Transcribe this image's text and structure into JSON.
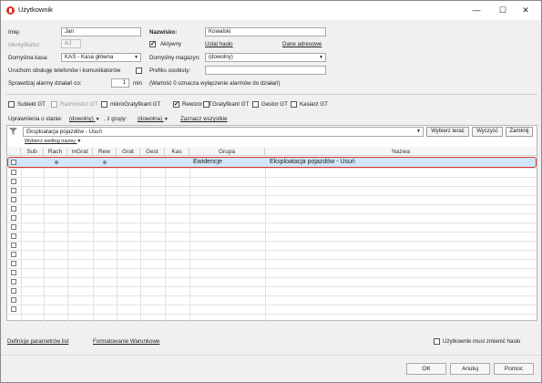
{
  "window": {
    "title": "Użytkownik",
    "minimize": "—",
    "maximize": "☐",
    "close": "✕"
  },
  "form": {
    "imie_label": "Imię:",
    "imie_value": "Jan",
    "nazwisko_label": "Nazwisko:",
    "nazwisko_value": "Kowalski",
    "identyfikator_label": "Identyfikator:",
    "identyfikator_value": "AJ",
    "aktywny_label": "Aktywny",
    "aktywny_checked": true,
    "ustal_haslo": "Ustal hasło",
    "dane_adresowe": "Dane adresowe",
    "kasa_label": "Domyślna kasa:",
    "kasa_value": "KAS - Kasa główna",
    "magazyn_label": "Domyślny magazyn:",
    "magazyn_value": "(dowolny)",
    "telefon_label": "Uruchom obsługę telefonów i komunikatorów",
    "telefon_checked": false,
    "prefiks_label": "Prefiks osobisty:",
    "prefiks_value": "",
    "alarmy_label": "Sprawdzaj alarmy działań co:",
    "alarmy_value": "1",
    "alarmy_unit": "min",
    "alarmy_note": "(Wartość 0 oznacza wyłączenie alarmów do działań)"
  },
  "roles": [
    {
      "label": "Subiekt GT",
      "checked": false,
      "disabled": false
    },
    {
      "label": "Rachmistrz GT",
      "checked": false,
      "disabled": true
    },
    {
      "label": "mikroGratyfikant GT",
      "checked": false,
      "disabled": false
    },
    {
      "label": "Rewizor GT",
      "checked": true,
      "disabled": false
    },
    {
      "label": "Gratyfikant GT",
      "checked": false,
      "disabled": false
    },
    {
      "label": "Gestor GT",
      "checked": false,
      "disabled": false
    },
    {
      "label": "Kasiarz GT",
      "checked": false,
      "disabled": false
    }
  ],
  "filters": {
    "uprawnienia_label": "Uprawnienia o stanie:",
    "uprawnienia_value": "(dowolny)",
    "grupy_label": ", z grupy:",
    "grupy_value": "(dowolna)",
    "zaznacz_wszystkie": "Zaznacz wszystkie"
  },
  "search": {
    "value": "Eksploatacja pojazdów - Usuń",
    "wybierz_teraz": "Wybierz teraz",
    "wyczysc": "Wyczyść",
    "zamknij": "Zamknij",
    "wybierz_wedlug": "Wybierz według nazwy"
  },
  "table": {
    "columns": [
      "Sub",
      "Rach",
      "mGrat",
      "Rew",
      "Grat",
      "Gest",
      "Kas",
      "Grupa",
      "Nazwa"
    ],
    "rows": [
      {
        "sub": false,
        "rach": true,
        "mgrat": false,
        "rew": true,
        "grat": false,
        "gest": false,
        "kas": false,
        "grupa": "Ewidencje",
        "nazwa": "Eksploatacja pojazdów - Usuń",
        "selected": true
      }
    ],
    "empty_rows": 17
  },
  "footer": {
    "definicje": "Definicje parametrów list",
    "formatowanie": "Formatowanie Warunkowe",
    "musi_zmienic": "Użytkownik musi zmienić hasło",
    "musi_zmienic_checked": false,
    "ok": "OK",
    "anuluj": "Anuluj",
    "pomoc": "Pomoc"
  },
  "colors": {
    "selection": "#cfe6fb",
    "selection_border": "#d9342b"
  }
}
